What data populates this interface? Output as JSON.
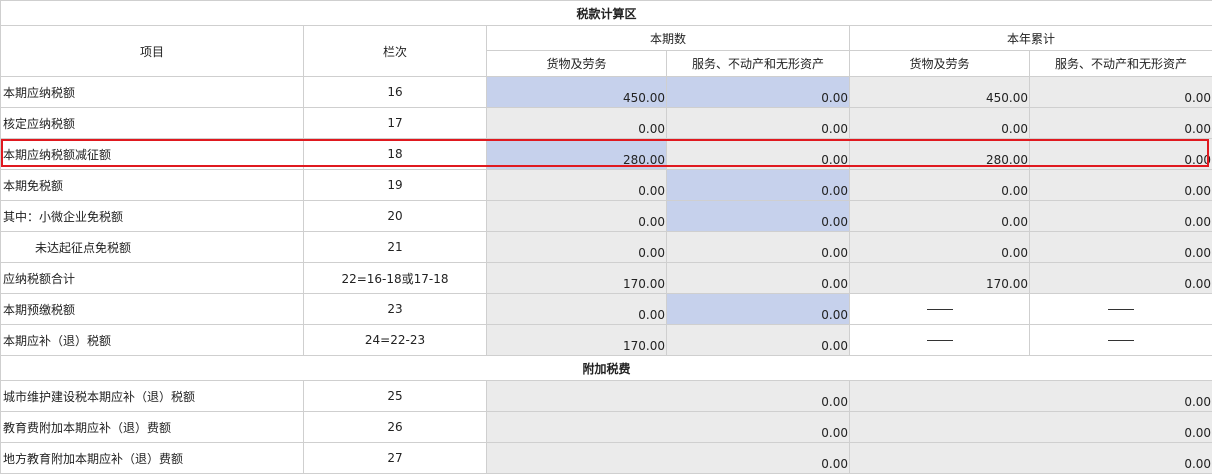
{
  "section_main_title": "税款计算区",
  "headers": {
    "item": "项目",
    "line": "栏次",
    "current": "本期数",
    "ytd": "本年累计",
    "goods": "货物及劳务",
    "services": "服务、不动产和无形资产"
  },
  "rows": [
    {
      "label": "本期应纳税额",
      "line": "16",
      "cur_goods": "450.00",
      "cur_serv": "0.00",
      "ytd_goods": "450.00",
      "ytd_serv": "0.00"
    },
    {
      "label": "核定应纳税额",
      "line": "17",
      "cur_goods": "0.00",
      "cur_serv": "0.00",
      "ytd_goods": "0.00",
      "ytd_serv": "0.00"
    },
    {
      "label": "本期应纳税额减征额",
      "line": "18",
      "cur_goods": "280.00",
      "cur_serv": "0.00",
      "ytd_goods": "280.00",
      "ytd_serv": "0.00"
    },
    {
      "label": "本期免税额",
      "line": "19",
      "cur_goods": "0.00",
      "cur_serv": "0.00",
      "ytd_goods": "0.00",
      "ytd_serv": "0.00"
    },
    {
      "label": "其中：小微企业免税额",
      "line": "20",
      "cur_goods": "0.00",
      "cur_serv": "0.00",
      "ytd_goods": "0.00",
      "ytd_serv": "0.00"
    },
    {
      "label": "未达起征点免税额",
      "line": "21",
      "cur_goods": "0.00",
      "cur_serv": "0.00",
      "ytd_goods": "0.00",
      "ytd_serv": "0.00"
    },
    {
      "label": "应纳税额合计",
      "line": "22=16-18或17-18",
      "cur_goods": "170.00",
      "cur_serv": "0.00",
      "ytd_goods": "170.00",
      "ytd_serv": "0.00"
    },
    {
      "label": "本期预缴税额",
      "line": "23",
      "cur_goods": "0.00",
      "cur_serv": "0.00"
    },
    {
      "label": "本期应补（退）税额",
      "line": "24=22-23",
      "cur_goods": "170.00",
      "cur_serv": "0.00"
    }
  ],
  "section_surtax_title": "附加税费",
  "surtax_rows": [
    {
      "label": "城市维护建设税本期应补（退）税额",
      "line": "25",
      "current": "0.00",
      "ytd": "0.00"
    },
    {
      "label": "教育费附加本期应补（退）费额",
      "line": "26",
      "current": "0.00",
      "ytd": "0.00"
    },
    {
      "label": "地方教育附加本期应补（退）费额",
      "line": "27",
      "current": "0.00",
      "ytd": "0.00"
    }
  ],
  "colors": {
    "editable_cell": "#c6d1ec",
    "readonly_cell": "#ebebeb",
    "highlight_border": "#e0191f"
  }
}
